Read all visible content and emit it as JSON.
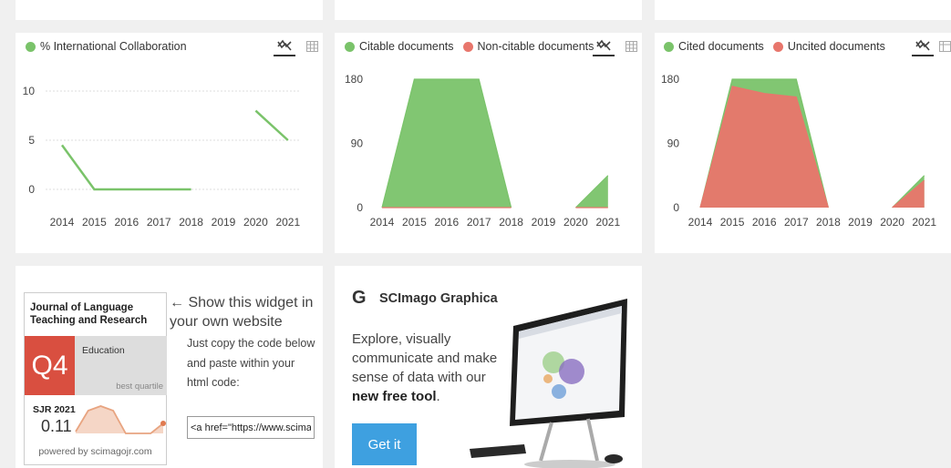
{
  "chart_data": [
    {
      "type": "line",
      "x": [
        "2014",
        "2015",
        "2016",
        "2017",
        "2018",
        "2019",
        "2020",
        "2021"
      ],
      "series": [
        {
          "name": "% International Collaboration",
          "values": [
            4.5,
            0,
            0,
            0,
            0,
            null,
            8,
            5
          ],
          "color": "#7ac36a"
        }
      ],
      "ylim": [
        0,
        10
      ],
      "yticks": [
        "10",
        "5",
        "0"
      ],
      "grid": "dashed"
    },
    {
      "type": "area",
      "x": [
        "2014",
        "2015",
        "2016",
        "2017",
        "2018",
        "2019",
        "2020",
        "2021"
      ],
      "series": [
        {
          "name": "Citable documents",
          "values": [
            0,
            180,
            180,
            180,
            0,
            null,
            0,
            45
          ],
          "color": "#7ac36a"
        },
        {
          "name": "Non-citable documents",
          "values": [
            0,
            0,
            0,
            0,
            0,
            null,
            0,
            0
          ],
          "color": "#e8766c"
        }
      ],
      "ylim": [
        0,
        180
      ],
      "yticks": [
        "180",
        "90",
        "0"
      ]
    },
    {
      "type": "area",
      "x": [
        "2014",
        "2015",
        "2016",
        "2017",
        "2018",
        "2019",
        "2020",
        "2021"
      ],
      "series": [
        {
          "name": "Cited documents",
          "values": [
            0,
            180,
            180,
            180,
            0,
            null,
            0,
            45
          ],
          "color": "#7ac36a"
        },
        {
          "name": "Uncited documents",
          "values": [
            0,
            170,
            160,
            155,
            0,
            null,
            0,
            38
          ],
          "color": "#e8766c"
        }
      ],
      "ylim": [
        0,
        180
      ],
      "yticks": [
        "180",
        "90",
        "0"
      ]
    }
  ],
  "widget": {
    "journal_title": "Journal of Language Teaching and Research",
    "quartile": "Q4",
    "category": "Education",
    "best_quartile_label": "best quartile",
    "sjr_label": "SJR 2021",
    "sjr_value": "0.11",
    "powered_by": "powered by scimagojr.com",
    "sparkline_values": [
      0.02,
      0.25,
      0.3,
      0.25,
      0.0,
      0.0,
      0.0,
      0.11
    ],
    "color": "#e8a480"
  },
  "widget_info": {
    "heading": "← Show this widget in your own website",
    "instructions": "Just copy the code below and paste within your html code:",
    "code_value": "<a href=\"https://www.scimagojr.com/journalsearch.php"
  },
  "graphica": {
    "logo": "G",
    "title": "SCImago Graphica",
    "text_plain": "Explore, visually communicate and make sense of data with our",
    "text_bold_1": "new",
    "text_bold_2": "free tool",
    "text_end": ".",
    "button_label": "Get it"
  },
  "icons": {
    "line_chart": "chart-line-icon",
    "table": "table-grid-icon"
  }
}
